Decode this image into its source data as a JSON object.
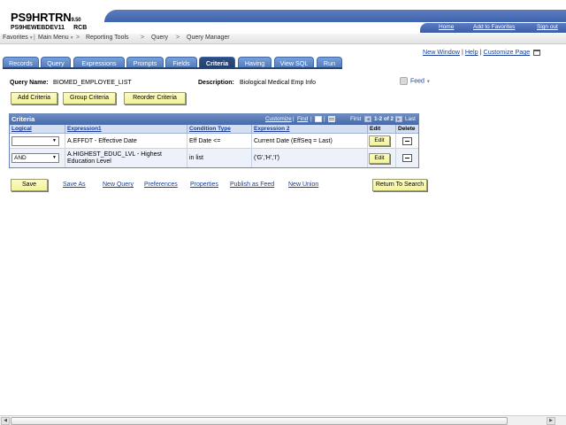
{
  "header": {
    "app_name": "PS9HRTRN",
    "version": "9.50",
    "server": "PS9HEWEBDEV11",
    "server_sub": "RCB",
    "links": [
      "Home",
      "Add to Favorites",
      "Sign out"
    ]
  },
  "breadcrumb": {
    "items": [
      "Favorites",
      "Main Menu",
      "Reporting Tools",
      "Query",
      "Query Manager"
    ],
    "separator": ">"
  },
  "utility_links": {
    "new_window": "New Window",
    "help": "Help",
    "customize": "Customize Page",
    "sep": "|"
  },
  "tabs": [
    {
      "label": "Records"
    },
    {
      "label": "Query"
    },
    {
      "label": "Expressions"
    },
    {
      "label": "Prompts"
    },
    {
      "label": "Fields"
    },
    {
      "label": "Criteria",
      "active": true
    },
    {
      "label": "Having"
    },
    {
      "label": "View SQL"
    },
    {
      "label": "Run"
    }
  ],
  "query": {
    "name_label": "Query Name:",
    "name_value": "BIOMED_EMPLOYEE_LIST",
    "desc_label": "Description:",
    "desc_value": "Biological Medical Emp Info"
  },
  "feed": {
    "label": "Feed"
  },
  "actions": {
    "add_criteria": "Add Criteria",
    "group_criteria": "Group Criteria",
    "reorder_criteria": "Reorder Criteria"
  },
  "criteria_grid": {
    "title": "Criteria",
    "customize": "Customize",
    "find": "Find",
    "first": "First",
    "range": "1-2 of 2",
    "last": "Last",
    "columns": [
      "Logical",
      "Expression1",
      "Condition Type",
      "Expression 2",
      "Edit",
      "Delete"
    ],
    "rows": [
      {
        "logical": "",
        "expr1": "A.EFFDT - Effective Date",
        "condition": "Eff Date <=",
        "expr2": "Current Date (EffSeq = Last)",
        "edit": "Edit"
      },
      {
        "logical": "AND",
        "expr1_line1": "A.HIGHEST_EDUC_LVL - Highest",
        "expr1_line2": "Education Level",
        "condition": "in list",
        "expr2": "('G','H','I')",
        "edit": "Edit"
      }
    ]
  },
  "bottom": {
    "save": "Save",
    "save_as": "Save As",
    "new_query": "New Query",
    "preferences": "Preferences",
    "properties": "Properties",
    "publish_feed": "Publish as Feed",
    "new_union": "New Union",
    "return_search": "Return To Search"
  },
  "colors": {
    "tab_blue": "#5a82c4",
    "tab_active": "#2a4676",
    "link_blue": "#1a3d96",
    "button_yellow": "#f6f6b0"
  }
}
